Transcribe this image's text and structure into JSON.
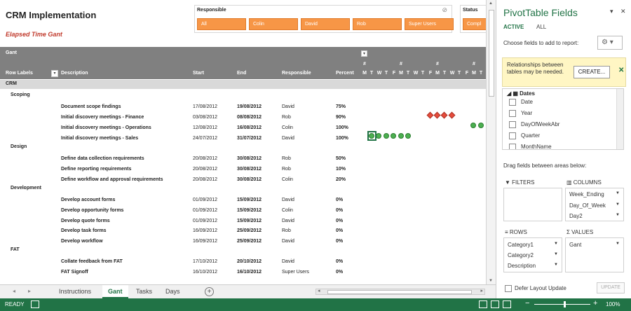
{
  "sheet": {
    "title": "CRM Implementation",
    "subtitle": "Elapsed Time Gant",
    "slicer_responsible": {
      "title": "Responsible",
      "buttons": [
        "All",
        "Colin",
        "David",
        "Rob",
        "Super Users"
      ]
    },
    "slicer_status": {
      "title": "Status",
      "button": "Compl"
    },
    "header": {
      "gant": "Gant",
      "row_labels": "Row Labels",
      "description": "Description",
      "start": "Start",
      "end": "End",
      "responsible": "Responsible",
      "percent": "Percent",
      "week_marks": [
        "#",
        "#",
        "#",
        "#"
      ],
      "days": [
        "M",
        "T",
        "W",
        "T",
        "F",
        "M",
        "T",
        "W",
        "T",
        "F",
        "M",
        "T",
        "W",
        "T",
        "F",
        "M",
        "T"
      ]
    },
    "group": "CRM",
    "categories": {
      "scoping": "Scoping",
      "design": "Design",
      "development": "Development",
      "fat": "FAT"
    },
    "rows": [
      {
        "description": "Document scope findings",
        "start": "17/08/2012",
        "end": "19/08/2012",
        "responsible": "David",
        "percent": "75%"
      },
      {
        "description": "Initial discovery meetings - Finance",
        "start": "03/08/2012",
        "end": "08/08/2012",
        "responsible": "Rob",
        "percent": "90%"
      },
      {
        "description": "Initial discovery meetings - Operations",
        "start": "12/08/2012",
        "end": "16/08/2012",
        "responsible": "Colin",
        "percent": "100%"
      },
      {
        "description": "Initial discovery meetings - Sales",
        "start": "24/07/2012",
        "end": "31/07/2012",
        "responsible": "David",
        "percent": "100%"
      },
      {
        "description": "Define data collection requirements",
        "start": "20/08/2012",
        "end": "30/08/2012",
        "responsible": "Rob",
        "percent": "50%"
      },
      {
        "description": "Define reporting requirements",
        "start": "20/08/2012",
        "end": "30/08/2012",
        "responsible": "Rob",
        "percent": "10%"
      },
      {
        "description": "Define workflow and approval requirements",
        "start": "20/08/2012",
        "end": "30/08/2012",
        "responsible": "Colin",
        "percent": "20%"
      },
      {
        "description": "Develop account forms",
        "start": "01/09/2012",
        "end": "15/09/2012",
        "responsible": "David",
        "percent": "0%"
      },
      {
        "description": "Develop opportunity forms",
        "start": "01/09/2012",
        "end": "15/09/2012",
        "responsible": "Colin",
        "percent": "0%"
      },
      {
        "description": "Develop quote forms",
        "start": "01/09/2012",
        "end": "15/09/2012",
        "responsible": "David",
        "percent": "0%"
      },
      {
        "description": "Develop task forms",
        "start": "16/09/2012",
        "end": "25/09/2012",
        "responsible": "Rob",
        "percent": "0%"
      },
      {
        "description": "Develop workflow",
        "start": "16/09/2012",
        "end": "25/09/2012",
        "responsible": "David",
        "percent": "0%"
      },
      {
        "description": "Collate feedback from FAT",
        "start": "17/10/2012",
        "end": "20/10/2012",
        "responsible": "David",
        "percent": "0%"
      },
      {
        "description": "FAT Signoff",
        "start": "16/10/2012",
        "end": "16/10/2012",
        "responsible": "Super Users",
        "percent": "0%"
      }
    ]
  },
  "tabs": [
    "Instructions",
    "Gant",
    "Tasks",
    "Days"
  ],
  "active_tab": "Gant",
  "status": {
    "ready": "READY",
    "zoom": "100%"
  },
  "pane": {
    "title": "PivotTable Fields",
    "tab_active": "ACTIVE",
    "tab_all": "ALL",
    "choose": "Choose fields to add to report:",
    "notice": "Relationships between tables may be needed.",
    "create": "CREATE...",
    "field_group": "Dates",
    "fields": [
      "Date",
      "Year",
      "DayOfWeekAbr",
      "Quarter",
      "MonthName"
    ],
    "drag": "Drag fields between areas below:",
    "filters": "FILTERS",
    "columns": "COLUMNS",
    "columns_items": [
      "Week_Ending",
      "Day_Of_Week",
      "Day2"
    ],
    "rows": "ROWS",
    "rows_items": [
      "Category1",
      "Category2",
      "Description"
    ],
    "values": "VALUES",
    "values_items": [
      "Gant"
    ],
    "defer": "Defer Layout Update",
    "update": "UPDATE"
  },
  "colors": {
    "accent": "#217346",
    "slicer": "#f79646",
    "header": "#808080",
    "dot": "#4caf50",
    "diamond": "#e74c3c"
  },
  "icons": [
    "clear-filter-icon",
    "filter-dropdown-icon",
    "gear-icon",
    "close-icon",
    "table-icon",
    "add-sheet-icon",
    "zoom-minus-icon",
    "zoom-plus-icon"
  ]
}
